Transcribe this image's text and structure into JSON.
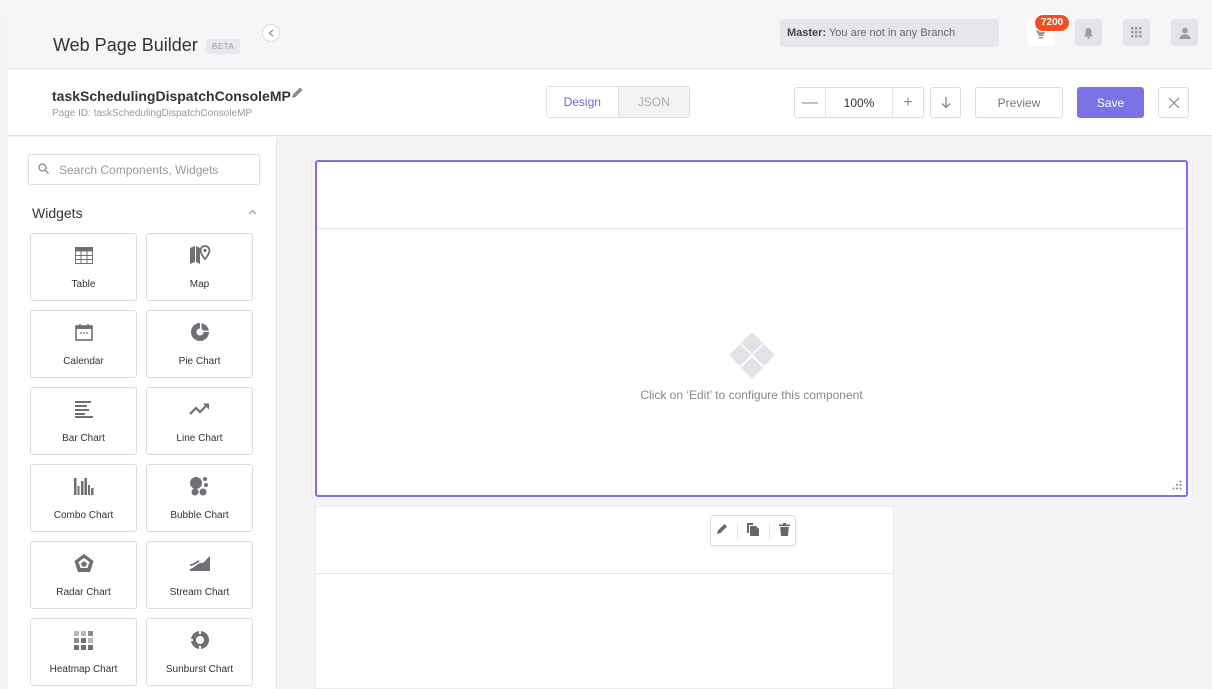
{
  "header": {
    "app_title": "Web Page Builder",
    "beta": "BETA",
    "branch_label": "Master:",
    "branch_text": " You are not in any Branch",
    "notification_count": "7200",
    "icons": [
      "bulb-icon",
      "bell-icon",
      "apps-grid-icon",
      "user-icon"
    ]
  },
  "page_bar": {
    "page_name": "taskSchedulingDispatchConsoleMP",
    "page_id": "Page ID: taskSchedulingDispatchConsoleMP",
    "mode_design": "Design",
    "mode_json": "JSON",
    "zoom_value": "100%",
    "preview_label": "Preview",
    "save_label": "Save"
  },
  "sidebar": {
    "search_placeholder": "Search Components, Widgets",
    "section_title": "Widgets",
    "widgets": [
      {
        "label": "Table",
        "icon": "table-icon"
      },
      {
        "label": "Map",
        "icon": "map-icon"
      },
      {
        "label": "Calendar",
        "icon": "calendar-icon"
      },
      {
        "label": "Pie Chart",
        "icon": "pie-chart-icon"
      },
      {
        "label": "Bar Chart",
        "icon": "bar-chart-icon"
      },
      {
        "label": "Line Chart",
        "icon": "line-chart-icon"
      },
      {
        "label": "Combo Chart",
        "icon": "combo-chart-icon"
      },
      {
        "label": "Bubble Chart",
        "icon": "bubble-chart-icon"
      },
      {
        "label": "Radar Chart",
        "icon": "radar-chart-icon"
      },
      {
        "label": "Stream Chart",
        "icon": "stream-chart-icon"
      },
      {
        "label": "Heatmap Chart",
        "icon": "heatmap-chart-icon"
      },
      {
        "label": "Sunburst Chart",
        "icon": "sunburst-chart-icon"
      }
    ]
  },
  "canvas": {
    "placeholder_text": "Click on ‘Edit’ to configure this component"
  },
  "colors": {
    "accent": "#7b72e6",
    "badge": "#f04e23",
    "icon_gray": "#6f6f76"
  }
}
